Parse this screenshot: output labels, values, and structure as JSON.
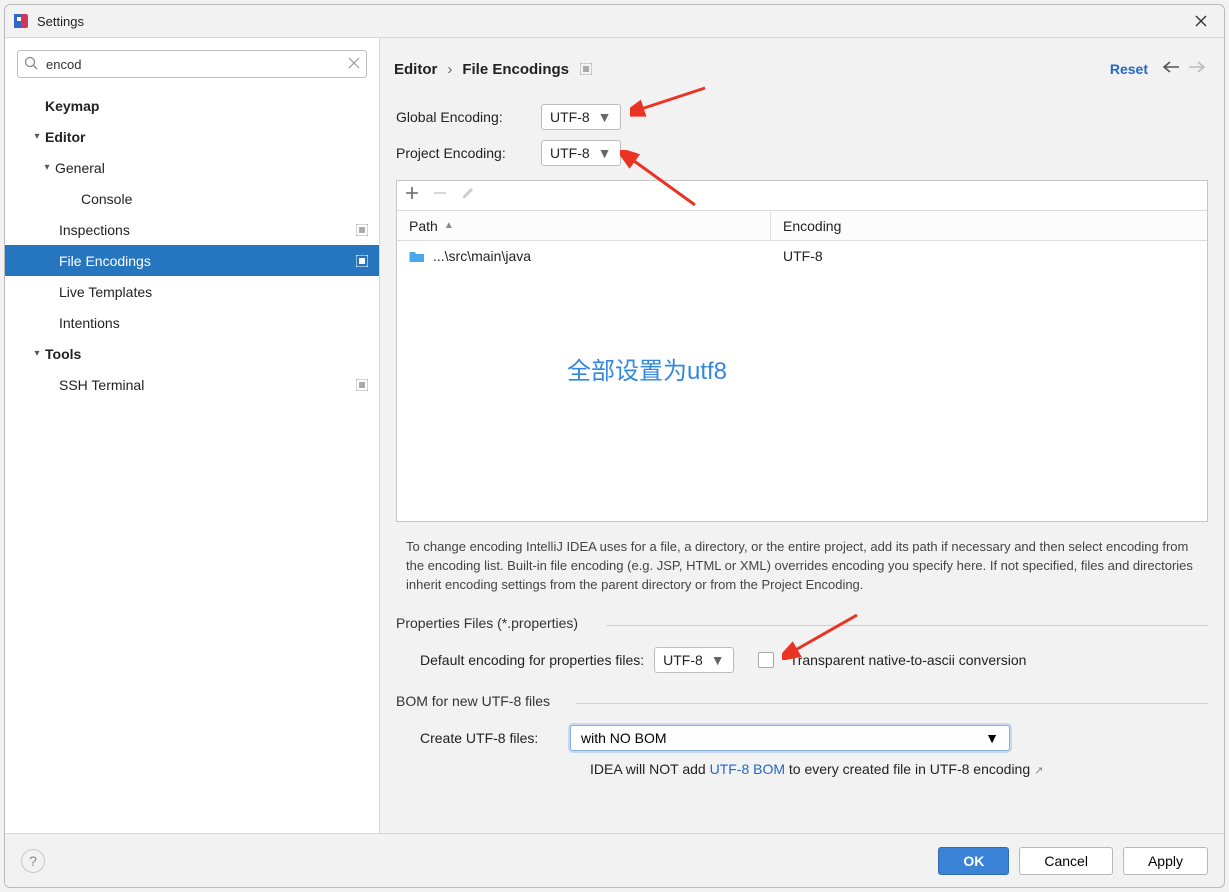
{
  "window": {
    "title": "Settings"
  },
  "search": {
    "value": "encod"
  },
  "tree": {
    "item0": "Keymap",
    "item1": "Editor",
    "item2": "General",
    "item3": "Console",
    "item4": "Inspections",
    "item5": "File Encodings",
    "item6": "Live Templates",
    "item7": "Intentions",
    "item8": "Tools",
    "item9": "SSH Terminal"
  },
  "breadcrumb": {
    "part1": "Editor",
    "sep": "›",
    "part2": "File Encodings"
  },
  "header": {
    "reset": "Reset"
  },
  "globalEncoding": {
    "label": "Global Encoding:",
    "value": "UTF-8"
  },
  "projectEncoding": {
    "label": "Project Encoding:",
    "value": "UTF-8"
  },
  "table": {
    "col1": "Path",
    "col2": "Encoding",
    "row0_path": "...\\src\\main\\java",
    "row0_enc": "UTF-8"
  },
  "annotation": "全部设置为utf8",
  "helpText": "To change encoding IntelliJ IDEA uses for a file, a directory, or the entire project, add its path if necessary and then select encoding from the encoding list. Built-in file encoding (e.g. JSP, HTML or XML) overrides encoding you specify here. If not specified, files and directories inherit encoding settings from the parent directory or from the Project Encoding.",
  "props": {
    "sectionTitle": "Properties Files (*.properties)",
    "label": "Default encoding for properties files:",
    "value": "UTF-8",
    "checkboxLabel": "Transparent native-to-ascii conversion"
  },
  "bom": {
    "sectionTitle": "BOM for new UTF-8 files",
    "label": "Create UTF-8 files:",
    "value": "with NO BOM",
    "footnote1": "IDEA will NOT add ",
    "footnoteLink": "UTF-8 BOM",
    "footnote2": " to every created file in UTF-8 encoding"
  },
  "buttons": {
    "ok": "OK",
    "cancel": "Cancel",
    "apply": "Apply"
  }
}
